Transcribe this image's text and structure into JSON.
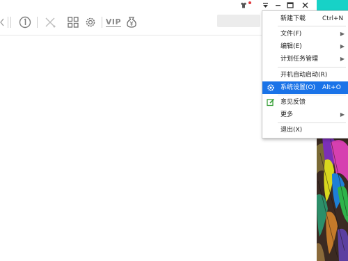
{
  "toolbar": {
    "icons": [
      "left-arrow-icon",
      "history-clock-icon",
      "cancel-icon",
      "app-grid-icon",
      "settings-gear-icon",
      "vip-badge",
      "money-pouch-icon"
    ],
    "vip_label": "VIP"
  },
  "window_controls": [
    "skin-icon",
    "menu-dropdown-icon",
    "minimize-icon",
    "maximize-icon",
    "close-icon"
  ],
  "context_menu": {
    "items": [
      {
        "label": "新建下载",
        "shortcut": "Ctrl+N",
        "submenu": false,
        "icon": ""
      },
      {
        "label": "文件(F)",
        "shortcut": "",
        "submenu": true,
        "icon": ""
      },
      {
        "label": "编辑(E)",
        "shortcut": "",
        "submenu": true,
        "icon": ""
      },
      {
        "label": "计划任务管理",
        "shortcut": "",
        "submenu": true,
        "icon": ""
      },
      {
        "label": "开机自动启动(R)",
        "shortcut": "",
        "submenu": false,
        "icon": ""
      },
      {
        "label": "系统设置(O)",
        "shortcut": "Alt+O",
        "submenu": false,
        "icon": "gear-icon",
        "highlighted": true
      },
      {
        "label": "意见反馈",
        "shortcut": "",
        "submenu": false,
        "icon": "feedback-edit-icon"
      },
      {
        "label": "更多",
        "shortcut": "",
        "submenu": true,
        "icon": ""
      },
      {
        "label": "退出(X)",
        "shortcut": "",
        "submenu": false,
        "icon": ""
      }
    ]
  },
  "colors": {
    "highlight": "#1a73e8",
    "feedback_icon": "#3aa03a",
    "side_cyan": "#17d2c7",
    "notification_dot": "#e0393e"
  }
}
